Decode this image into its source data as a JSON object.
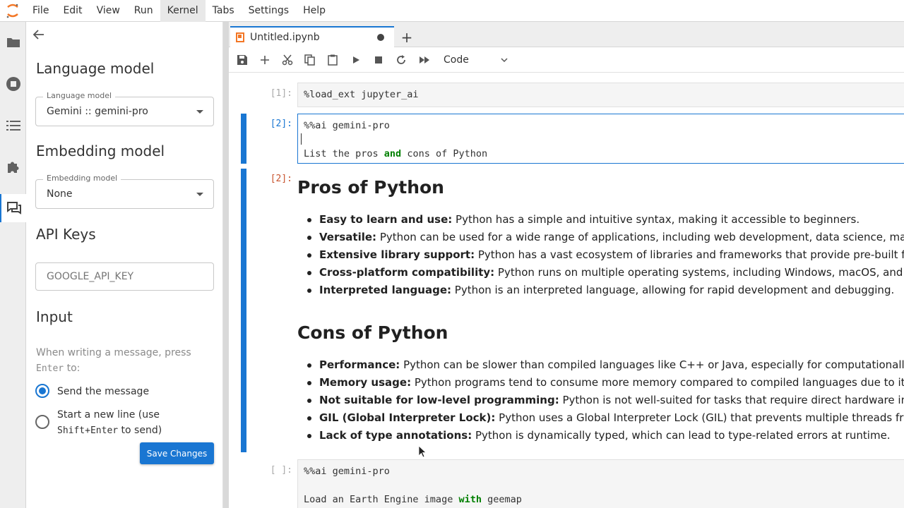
{
  "menu": [
    "File",
    "Edit",
    "View",
    "Run",
    "Kernel",
    "Tabs",
    "Settings",
    "Help"
  ],
  "menu_active": "Kernel",
  "activity_icons": [
    "folder-icon",
    "stop-circle-icon",
    "list-icon",
    "puzzle-icon",
    "chat-icon"
  ],
  "settings": {
    "language_model": {
      "title": "Language model",
      "legend": "Language model",
      "value": "Gemini :: gemini-pro"
    },
    "embedding_model": {
      "title": "Embedding model",
      "legend": "Embedding model",
      "value": "None"
    },
    "api_keys": {
      "title": "API Keys",
      "placeholder": "GOOGLE_API_KEY"
    },
    "input": {
      "title": "Input",
      "help_prefix": "When writing a message, press",
      "help_key": "Enter",
      "help_suffix": "to:",
      "option_send": "Send the message",
      "option_newline_prefix": "Start a new line (use",
      "option_newline_key": "Shift+Enter",
      "option_newline_suffix": "to send)",
      "selected": "send"
    },
    "save_label": "Save Changes"
  },
  "tab": {
    "label": "Untitled.ipynb"
  },
  "toolbar": {
    "cell_type": "Code"
  },
  "cells": {
    "c1": {
      "prompt": "[1]:",
      "code": "%load_ext jupyter_ai"
    },
    "c2": {
      "prompt": "[2]:",
      "line1": "%%ai gemini-pro",
      "line3_a": "List the pros ",
      "line3_kw": "and",
      "line3_b": " cons of Python"
    },
    "out2": {
      "prompt": "[2]:",
      "pros_title": "Pros of Python",
      "pros": [
        {
          "term": "Easy to learn and use:",
          "text": " Python has a simple and intuitive syntax, making it accessible to beginners."
        },
        {
          "term": "Versatile:",
          "text": " Python can be used for a wide range of applications, including web development, data science, machine"
        },
        {
          "term": "Extensive library support:",
          "text": " Python has a vast ecosystem of libraries and frameworks that provide pre-built functionality"
        },
        {
          "term": "Cross-platform compatibility:",
          "text": " Python runs on multiple operating systems, including Windows, macOS, and Linux"
        },
        {
          "term": "Interpreted language:",
          "text": " Python is an interpreted language, allowing for rapid development and debugging."
        }
      ],
      "cons_title": "Cons of Python",
      "cons": [
        {
          "term": "Performance:",
          "text": " Python can be slower than compiled languages like C++ or Java, especially for computationally intensive"
        },
        {
          "term": "Memory usage:",
          "text": " Python programs tend to consume more memory compared to compiled languages due to its dynamic"
        },
        {
          "term": "Not suitable for low-level programming:",
          "text": " Python is not well-suited for tasks that require direct hardware interaction"
        },
        {
          "term": "GIL (Global Interpreter Lock):",
          "text": " Python uses a Global Interpreter Lock (GIL) that prevents multiple threads from executing"
        },
        {
          "term": "Lack of type annotations:",
          "text": " Python is dynamically typed, which can lead to type-related errors at runtime."
        }
      ]
    },
    "c3": {
      "prompt": "[ ]:",
      "line1": "%%ai gemini-pro",
      "line3_a": "Load an Earth Engine image ",
      "line3_kw": "with",
      "line3_b": " geemap"
    }
  },
  "colors": {
    "accent": "#1976d2",
    "keyword": "#008000",
    "out_prompt": "#c8532e"
  }
}
